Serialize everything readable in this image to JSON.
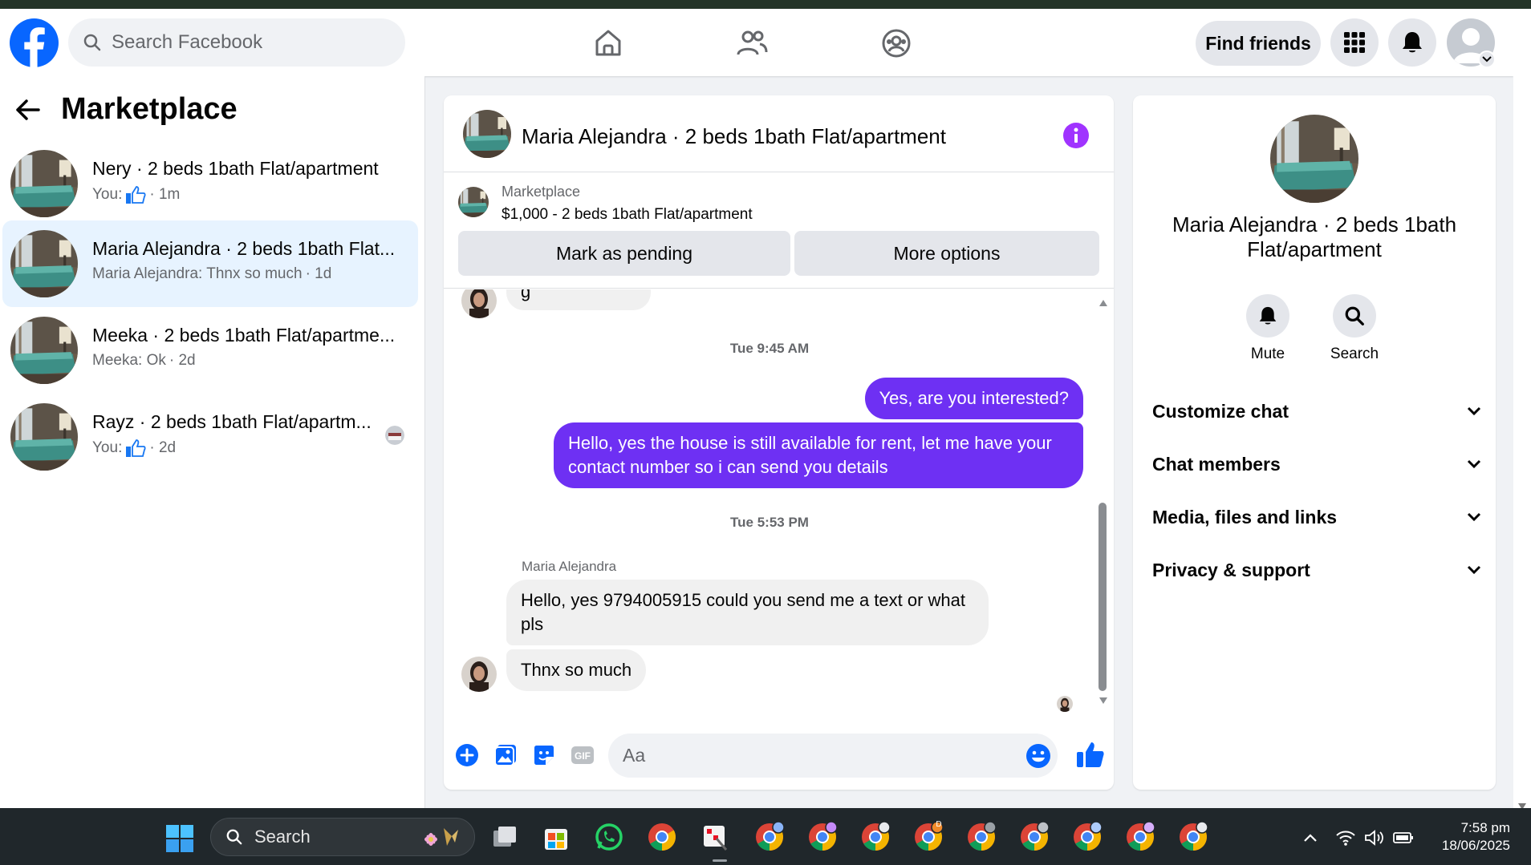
{
  "app": {
    "name": "Facebook Marketplace Messenger"
  },
  "topnav": {
    "search_placeholder": "Search Facebook",
    "find_friends_label": "Find friends",
    "icons": [
      "facebook-logo",
      "home-icon",
      "friends-icon",
      "groups-icon",
      "apps-grid-icon",
      "bell-icon",
      "profile-avatar"
    ]
  },
  "left_panel": {
    "title": "Marketplace",
    "conversations": [
      {
        "title": "Nery · 2 beds 1bath Flat/apartment",
        "sub_prefix": "You:",
        "sub_has_like": true,
        "sub_time": "· 1m",
        "active": false
      },
      {
        "title": "Maria Alejandra · 2 beds 1bath Flat...",
        "sub_prefix": "Maria Alejandra: Thnx so much",
        "sub_has_like": false,
        "sub_time": "· 1d",
        "active": true
      },
      {
        "title": "Meeka · 2 beds 1bath Flat/apartme...",
        "sub_prefix": "Meeka: Ok",
        "sub_has_like": false,
        "sub_time": "· 2d",
        "active": false
      },
      {
        "title": "Rayz · 2 beds 1bath Flat/apartm...",
        "sub_prefix": "You:",
        "sub_has_like": true,
        "sub_time": "· 2d",
        "active": false
      }
    ]
  },
  "chat": {
    "title": "Maria Alejandra · 2 beds 1bath Flat/apartment",
    "marketplace_label": "Marketplace",
    "listing": "$1,000 - 2 beds 1bath Flat/apartment",
    "btn_pending": "Mark as pending",
    "btn_more": "More options",
    "partial_top_text": "g",
    "timestamp1": "Tue 9:45 AM",
    "out_msg1": "Yes, are you interested?",
    "out_msg2": "Hello, yes the house is still available for rent, let me have your contact number so i can send you details",
    "timestamp2": "Tue 5:53 PM",
    "sender_name": "Maria Alejandra",
    "in_msg1": "Hello, yes 9794005915 could you send me a text or what pls",
    "in_msg2": "Thnx so much",
    "composer_placeholder": "Aa"
  },
  "right_panel": {
    "name": "Maria Alejandra · 2 beds 1bath Flat/apartment",
    "mute_label": "Mute",
    "search_label": "Search",
    "rows": [
      "Customize chat",
      "Chat members",
      "Media, files and links",
      "Privacy & support"
    ]
  },
  "taskbar": {
    "search_label": "Search",
    "time": "7:58 pm",
    "date": "18/06/2025",
    "badge": "D"
  },
  "colors": {
    "brand": "#0866ff",
    "outgoing": "#6e30f3",
    "info": "#a033ff",
    "active_row": "#e7f3ff"
  }
}
